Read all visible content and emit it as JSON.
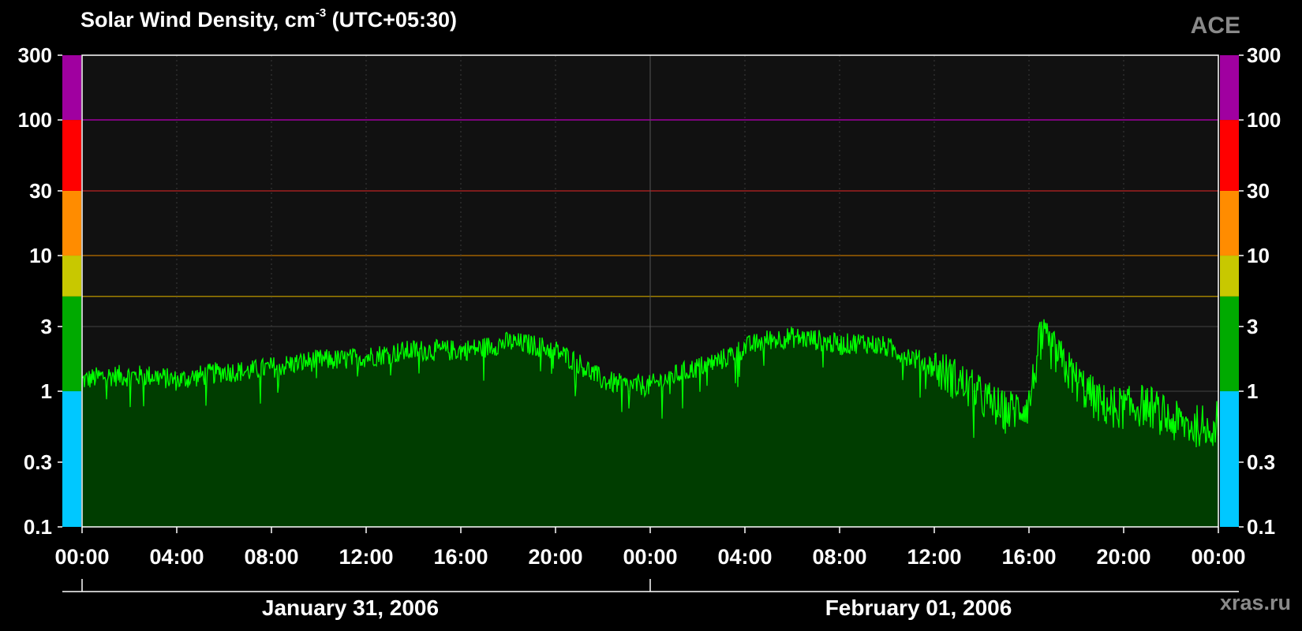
{
  "header": {
    "title_main": "Solar Wind Density, cm",
    "title_exp": "-3",
    "title_tz": " (UTC+05:30)",
    "brand": "ACE",
    "credit": "xras.ru"
  },
  "colors": {
    "background": "#000000",
    "plot_bg": "#111111",
    "fill": "#003d00",
    "line": "#00ff00",
    "grid": "#444444",
    "axis": "#ffffff"
  },
  "chart_data": {
    "type": "area",
    "title": "Solar Wind Density, cm-3 (UTC+05:30)",
    "ylabel": "",
    "xlabel": "",
    "y_scale": "log",
    "ylim": [
      0.1,
      300
    ],
    "y_ticks": [
      {
        "value": 300,
        "label": "300"
      },
      {
        "value": 100,
        "label": "100"
      },
      {
        "value": 30,
        "label": "30"
      },
      {
        "value": 10,
        "label": "10"
      },
      {
        "value": 3,
        "label": "3"
      },
      {
        "value": 1,
        "label": "1"
      },
      {
        "value": 0.3,
        "label": "0.3"
      },
      {
        "value": 0.1,
        "label": "0.1"
      }
    ],
    "xlim": [
      "2006-01-31 00:00",
      "2006-02-02 00:00"
    ],
    "x_ticks": [
      "00:00",
      "04:00",
      "08:00",
      "12:00",
      "16:00",
      "20:00",
      "00:00",
      "04:00",
      "08:00",
      "12:00",
      "16:00",
      "20:00",
      "00:00"
    ],
    "x_tick_hours": [
      0,
      4,
      8,
      12,
      16,
      20,
      24,
      28,
      32,
      36,
      40,
      44,
      48
    ],
    "date_labels": [
      {
        "label": "January 31, 2006",
        "start_hour": 0,
        "end_hour": 24
      },
      {
        "label": "February 01, 2006",
        "start_hour": 24,
        "end_hour": 48
      }
    ],
    "threshold_bands": [
      {
        "from": 0.1,
        "to": 1,
        "color": "#00c8ff"
      },
      {
        "from": 1,
        "to": 5,
        "color": "#00aa00"
      },
      {
        "from": 5,
        "to": 10,
        "color": "#c8c800"
      },
      {
        "from": 10,
        "to": 30,
        "color": "#ff8c00"
      },
      {
        "from": 30,
        "to": 100,
        "color": "#ff0000"
      },
      {
        "from": 100,
        "to": 300,
        "color": "#a000a0"
      }
    ],
    "threshold_lines": [
      {
        "value": 100,
        "color": "#a000a0"
      },
      {
        "value": 30,
        "color": "#a02020"
      },
      {
        "value": 10,
        "color": "#a06000"
      },
      {
        "value": 5,
        "color": "#a08000"
      }
    ],
    "grid": true,
    "series": [
      {
        "x": [
          "2006-01-31 00:00",
          "2006-01-31 01:00",
          "2006-01-31 02:00",
          "2006-01-31 03:00",
          "2006-01-31 04:00",
          "2006-01-31 05:00",
          "2006-01-31 06:00",
          "2006-01-31 07:00",
          "2006-01-31 08:00",
          "2006-01-31 09:00",
          "2006-01-31 10:00",
          "2006-01-31 11:00",
          "2006-01-31 12:00",
          "2006-01-31 13:00",
          "2006-01-31 14:00",
          "2006-01-31 15:00",
          "2006-01-31 16:00",
          "2006-01-31 17:00",
          "2006-01-31 18:00",
          "2006-01-31 19:00",
          "2006-01-31 20:00",
          "2006-01-31 21:00",
          "2006-01-31 22:00",
          "2006-01-31 23:00",
          "2006-02-01 00:00",
          "2006-02-01 01:00",
          "2006-02-01 02:00",
          "2006-02-01 03:00",
          "2006-02-01 04:00",
          "2006-02-01 05:00",
          "2006-02-01 06:00",
          "2006-02-01 07:00",
          "2006-02-01 08:00",
          "2006-02-01 09:00",
          "2006-02-01 10:00",
          "2006-02-01 11:00",
          "2006-02-01 12:00",
          "2006-02-01 13:00",
          "2006-02-01 14:00",
          "2006-02-01 15:00",
          "2006-02-01 16:00",
          "2006-02-01 16:30",
          "2006-02-01 17:00",
          "2006-02-01 18:00",
          "2006-02-01 19:00",
          "2006-02-01 20:00",
          "2006-02-01 21:00",
          "2006-02-01 22:00",
          "2006-02-01 23:00",
          "2006-02-02 00:00"
        ],
        "y": [
          1.2,
          1.3,
          1.3,
          1.3,
          1.2,
          1.3,
          1.4,
          1.4,
          1.5,
          1.6,
          1.7,
          1.7,
          1.8,
          1.9,
          2.0,
          2.0,
          2.0,
          2.1,
          2.3,
          2.2,
          2.0,
          1.6,
          1.2,
          1.1,
          1.1,
          1.3,
          1.5,
          1.7,
          2.1,
          2.4,
          2.5,
          2.4,
          2.2,
          2.3,
          2.1,
          1.8,
          1.5,
          1.2,
          0.9,
          0.7,
          0.8,
          2.5,
          2.0,
          1.2,
          0.8,
          0.75,
          0.8,
          0.6,
          0.55,
          0.6
        ]
      }
    ]
  }
}
